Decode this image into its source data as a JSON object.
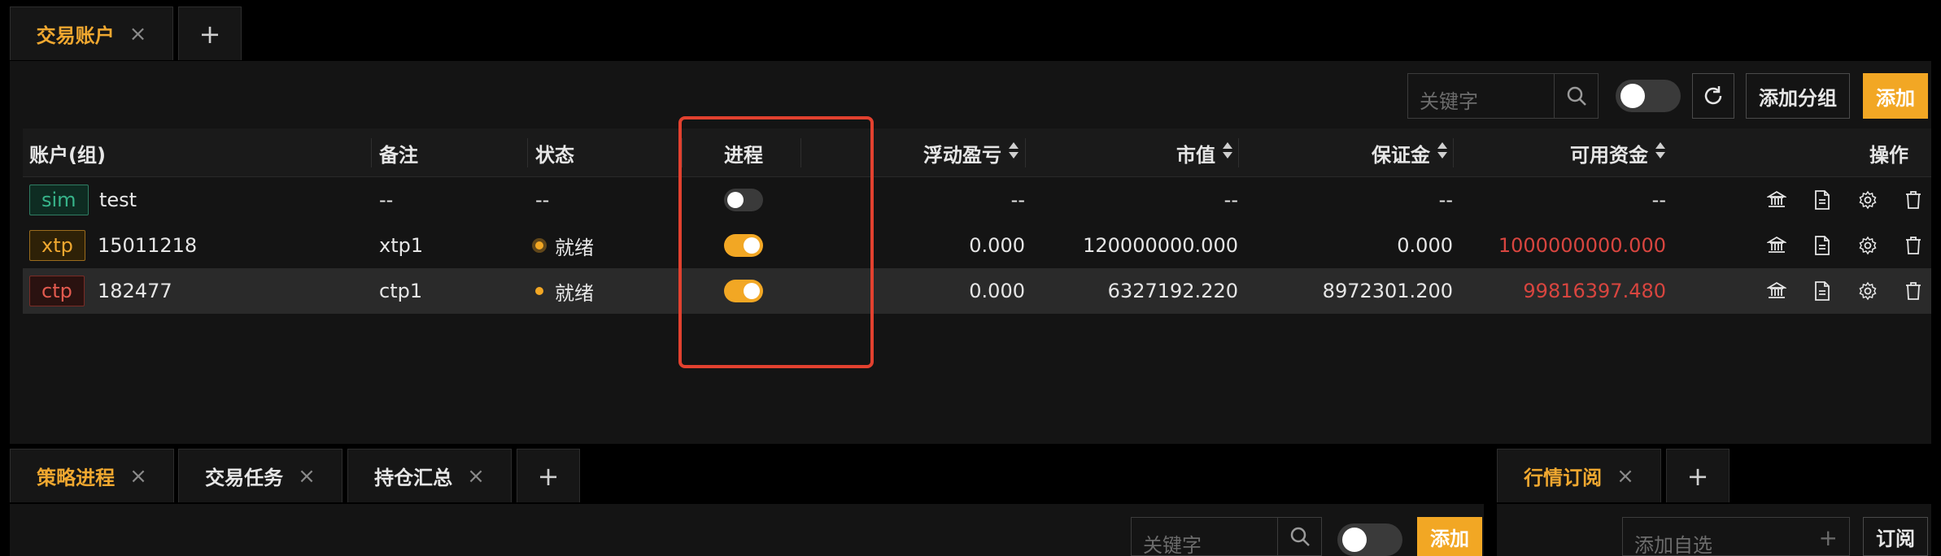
{
  "top_tabs": [
    {
      "label": "交易账户",
      "close": "×"
    }
  ],
  "tab_plus": "+",
  "toolbar": {
    "search_placeholder": "关键字",
    "add_group": "添加分组",
    "add": "添加"
  },
  "table": {
    "headers": {
      "account": "账户(组)",
      "note": "备注",
      "status": "状态",
      "process": "进程",
      "float_pnl": "浮动盈亏",
      "market_value": "市值",
      "margin": "保证金",
      "available": "可用资金",
      "actions": "操作"
    },
    "rows": [
      {
        "tag": "sim",
        "account": "test",
        "note": "--",
        "status": "--",
        "process_on": false,
        "float_pnl": "--",
        "market_value": "--",
        "margin": "--",
        "available": "--"
      },
      {
        "tag": "xtp",
        "account": "15011218",
        "note": "xtp1",
        "status": "就绪",
        "process_on": true,
        "float_pnl": "0.000",
        "market_value": "120000000.000",
        "margin": "0.000",
        "available": "1000000000.000"
      },
      {
        "tag": "ctp",
        "account": "182477",
        "note": "ctp1",
        "status": "就绪",
        "process_on": true,
        "float_pnl": "0.000",
        "market_value": "6327192.220",
        "margin": "8972301.200",
        "available": "99816397.480"
      }
    ]
  },
  "bottom_left_tabs": [
    {
      "label": "策略进程",
      "close": "×"
    },
    {
      "label": "交易任务",
      "close": "×"
    },
    {
      "label": "持仓汇总",
      "close": "×"
    }
  ],
  "bottom_right_tabs": [
    {
      "label": "行情订阅",
      "close": "×"
    }
  ],
  "bottom_left_toolbar": {
    "search_placeholder": "关键字",
    "add": "添加"
  },
  "bottom_right_toolbar": {
    "input_placeholder": "添加自选",
    "input_plus": "+",
    "subscribe": "订阅"
  },
  "colors": {
    "accent": "#f2a724",
    "negative": "#d8453f",
    "highlight_box": "#e2412f"
  }
}
